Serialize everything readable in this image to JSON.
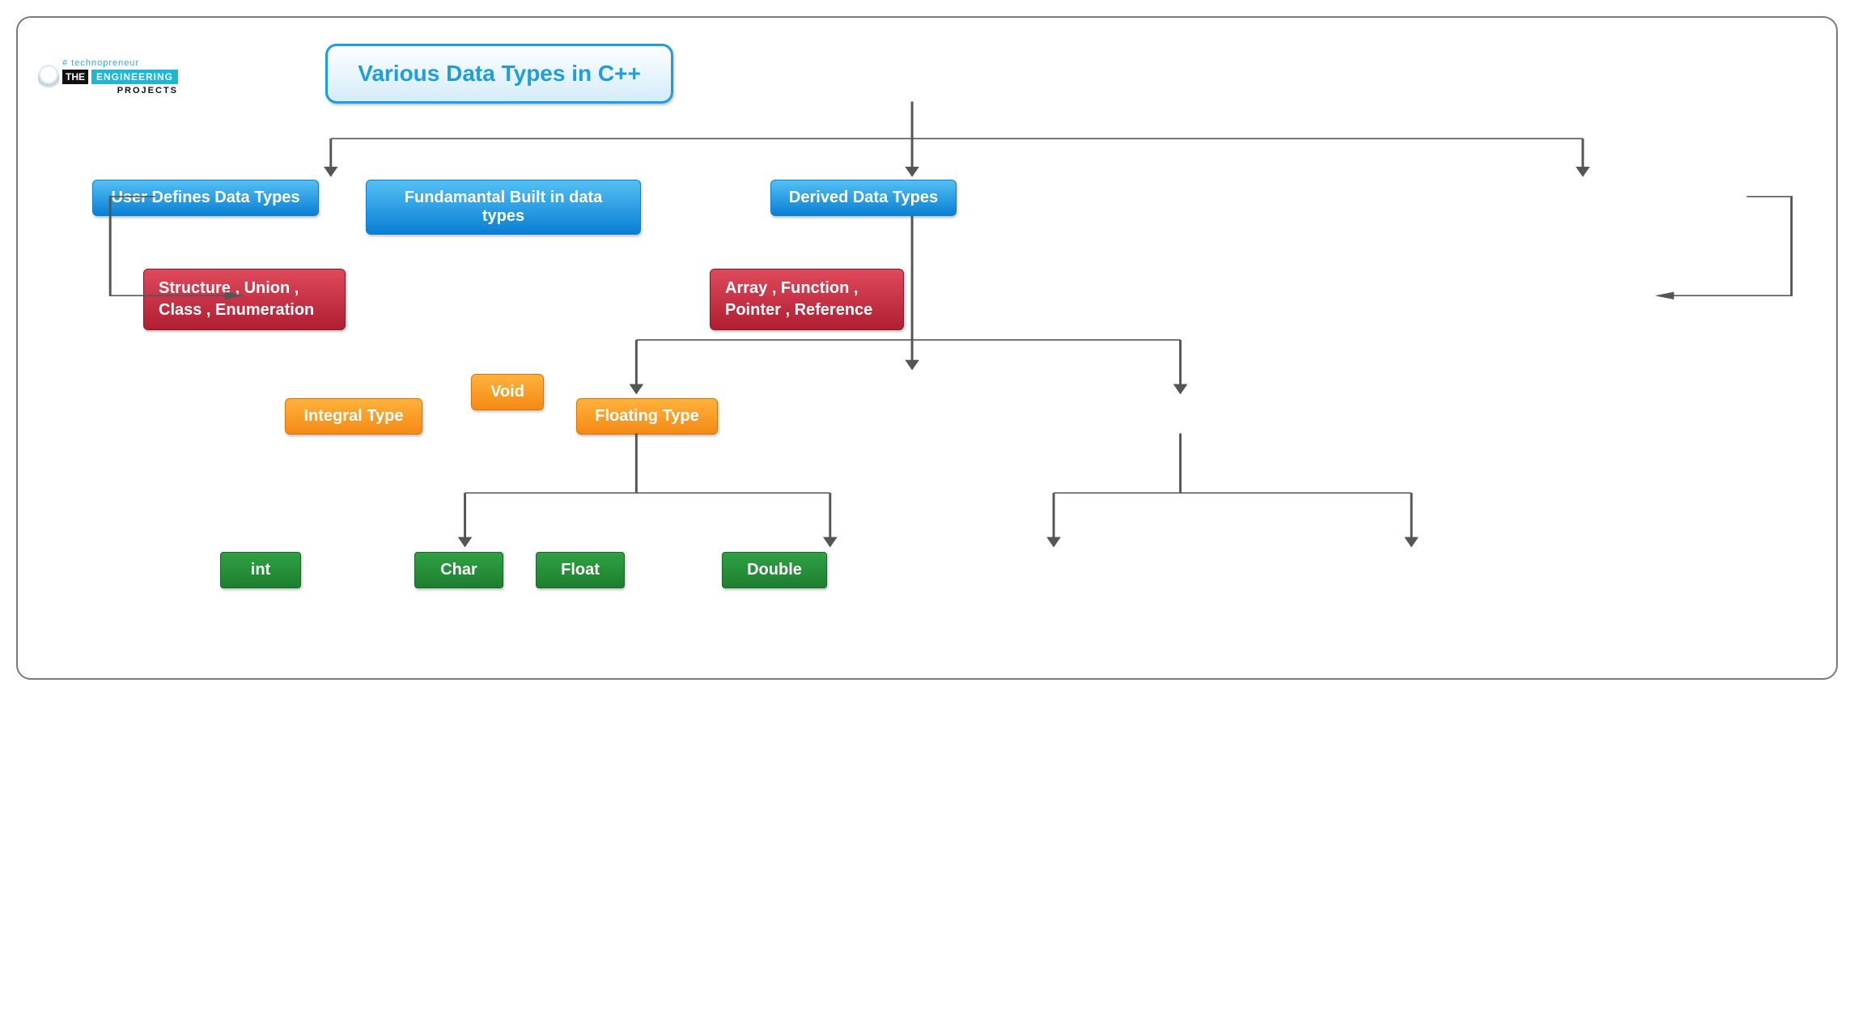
{
  "logo": {
    "hashtag": "# technopreneur",
    "the": "THE",
    "engineering": "ENGINEERING",
    "projects": "PROJECTS"
  },
  "root": {
    "title": "Various Data Types in C++"
  },
  "level1": {
    "user_defines": "User Defines Data Types",
    "fundamental": "Fundamantal Built in data types",
    "derived": "Derived Data Types"
  },
  "red_left": {
    "line1": "Structure , Union ,",
    "line2": "Class , Enumeration"
  },
  "red_right": {
    "line1": "Array , Function ,",
    "line2": "Pointer , Reference"
  },
  "orange": {
    "integral": "Integral Type",
    "void": "Void",
    "floating": "Floating Type"
  },
  "green": {
    "int": "int",
    "char": "Char",
    "float": "Float",
    "double": "Double"
  }
}
